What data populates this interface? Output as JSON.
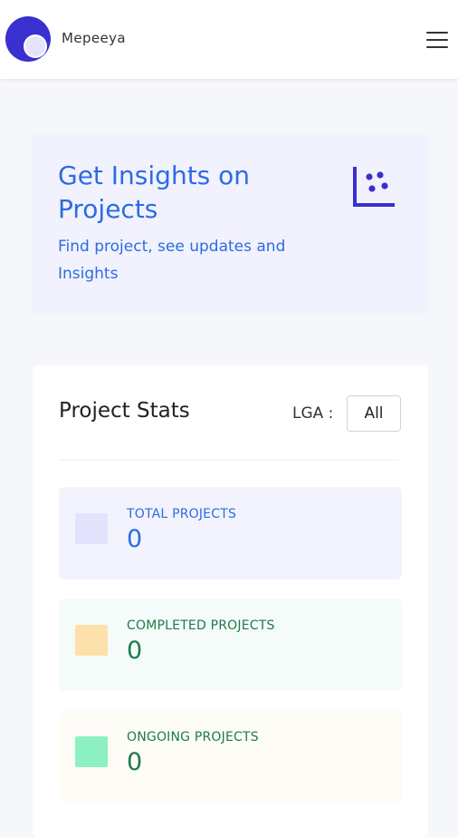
{
  "header": {
    "app_name": "Mepeeya"
  },
  "insights": {
    "title": "Get Insights on Projects",
    "subtitle": "Find project, see updates and Insights"
  },
  "stats": {
    "title": "Project Stats",
    "lga_label": "LGA :",
    "lga_value": "All",
    "items": [
      {
        "label": "TOTAL PROJECTS",
        "value": "0",
        "bg": "#f3f3fd",
        "swatch": "#e4e2fc",
        "color": "#2c6ce0"
      },
      {
        "label": "COMPLETED PROJECTS",
        "value": "0",
        "bg": "#f4fbf8",
        "swatch": "#fde0aa",
        "color": "#1e7a4a"
      },
      {
        "label": "ONGOING PROJECTS",
        "value": "0",
        "bg": "#fdfcf6",
        "swatch": "#8cf0c2",
        "color": "#1e7a4a"
      }
    ]
  },
  "colors": {
    "accent": "#2c6ce0",
    "logo": "#3a2fcf"
  }
}
